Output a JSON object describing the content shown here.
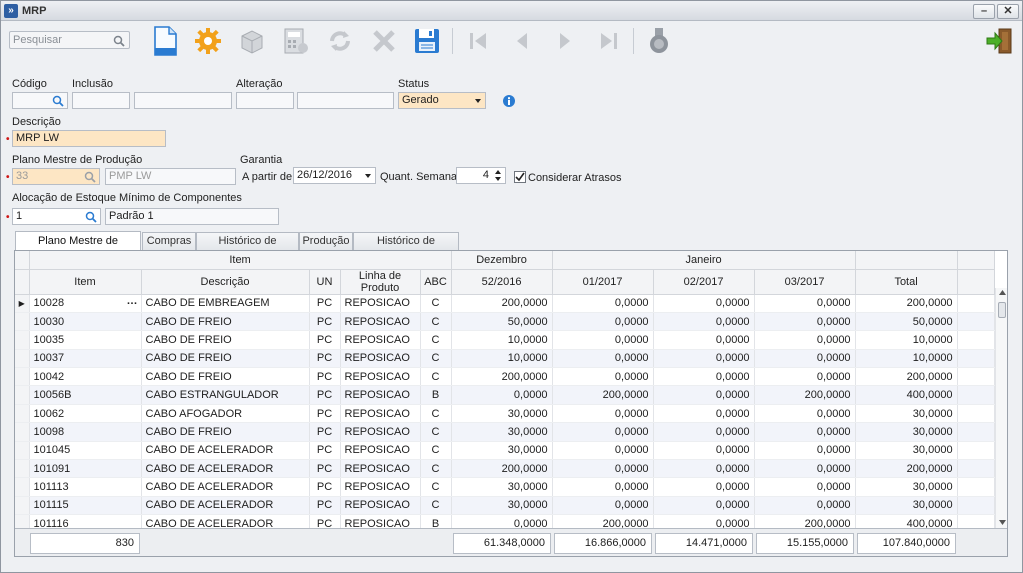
{
  "window": {
    "title": "MRP",
    "app_icon": "»",
    "min_label": "–",
    "close_label": "✕"
  },
  "toolbar": {
    "search_placeholder": "Pesquisar",
    "buttons": [
      "new-document-icon",
      "settings-gear-icon",
      "package-icon",
      "calculator-icon",
      "refresh-icon",
      "delete-x-icon",
      "save-disk-icon",
      "first-record-icon",
      "previous-record-icon",
      "next-record-icon",
      "last-record-icon",
      "medal-icon",
      "exit-door-icon"
    ]
  },
  "form": {
    "codigo_label": "Código",
    "inclusao_label": "Inclusão",
    "alteracao_label": "Alteração",
    "status_label": "Status",
    "status_value": "Gerado",
    "descricao_label": "Descrição",
    "descricao_value": "MRP LW",
    "plano_label": "Plano Mestre de Produção",
    "plano_code": "33",
    "plano_name": "PMP LW",
    "garantia_label": "Garantia",
    "a_partir_label": "A partir de",
    "a_partir_value": "26/12/2016",
    "quant_semanas_label": "Quant. Semanas",
    "quant_semanas_value": "4",
    "considerar_label": "Considerar Atrasos",
    "considerar_checked": true,
    "alocacao_label": "Alocação de Estoque Mínimo de Componentes",
    "alocacao_code": "1",
    "alocacao_name": "Padrão 1"
  },
  "tabs": [
    "Plano Mestre de Produção",
    "Compras",
    "Histórico de Compras",
    "Produção",
    "Histórico de Produção"
  ],
  "grid": {
    "group_headers": {
      "item": "Item",
      "dezembro": "Dezembro",
      "janeiro": "Janeiro"
    },
    "columns": [
      "Item",
      "Descrição",
      "UN",
      "Linha de Produto",
      "ABC",
      "52/2016",
      "01/2017",
      "02/2017",
      "03/2017",
      "Total"
    ],
    "rows": [
      [
        "10028",
        "CABO DE EMBREAGEM",
        "PC",
        "REPOSICAO",
        "C",
        "200,0000",
        "0,0000",
        "0,0000",
        "0,0000",
        "200,0000"
      ],
      [
        "10030",
        "CABO DE FREIO",
        "PC",
        "REPOSICAO",
        "C",
        "50,0000",
        "0,0000",
        "0,0000",
        "0,0000",
        "50,0000"
      ],
      [
        "10035",
        "CABO DE FREIO",
        "PC",
        "REPOSICAO",
        "C",
        "10,0000",
        "0,0000",
        "0,0000",
        "0,0000",
        "10,0000"
      ],
      [
        "10037",
        "CABO DE FREIO",
        "PC",
        "REPOSICAO",
        "C",
        "10,0000",
        "0,0000",
        "0,0000",
        "0,0000",
        "10,0000"
      ],
      [
        "10042",
        "CABO DE FREIO",
        "PC",
        "REPOSICAO",
        "C",
        "200,0000",
        "0,0000",
        "0,0000",
        "0,0000",
        "200,0000"
      ],
      [
        "10056B",
        "CABO ESTRANGULADOR",
        "PC",
        "REPOSICAO",
        "B",
        "0,0000",
        "200,0000",
        "0,0000",
        "200,0000",
        "400,0000"
      ],
      [
        "10062",
        "CABO AFOGADOR",
        "PC",
        "REPOSICAO",
        "C",
        "30,0000",
        "0,0000",
        "0,0000",
        "0,0000",
        "30,0000"
      ],
      [
        "10098",
        "CABO DE FREIO",
        "PC",
        "REPOSICAO",
        "C",
        "30,0000",
        "0,0000",
        "0,0000",
        "0,0000",
        "30,0000"
      ],
      [
        "101045",
        "CABO DE ACELERADOR",
        "PC",
        "REPOSICAO",
        "C",
        "30,0000",
        "0,0000",
        "0,0000",
        "0,0000",
        "30,0000"
      ],
      [
        "101091",
        "CABO DE ACELERADOR",
        "PC",
        "REPOSICAO",
        "C",
        "200,0000",
        "0,0000",
        "0,0000",
        "0,0000",
        "200,0000"
      ],
      [
        "101113",
        "CABO DE ACELERADOR",
        "PC",
        "REPOSICAO",
        "C",
        "30,0000",
        "0,0000",
        "0,0000",
        "0,0000",
        "30,0000"
      ],
      [
        "101115",
        "CABO DE ACELERADOR",
        "PC",
        "REPOSICAO",
        "C",
        "30,0000",
        "0,0000",
        "0,0000",
        "0,0000",
        "30,0000"
      ],
      [
        "101116",
        "CABO DE ACELERADOR",
        "PC",
        "REPOSICAO",
        "B",
        "0,0000",
        "200,0000",
        "0,0000",
        "200,0000",
        "400,0000"
      ]
    ],
    "footer": {
      "count": "830",
      "w52": "61.348,0000",
      "w01": "16.866,0000",
      "w02": "14.471,0000",
      "w03": "15.155,0000",
      "total": "107.840,0000"
    }
  },
  "colors": {
    "required_field_bg": "#fde6c4",
    "accent": "#2e5fa3",
    "required_marker": "#d01818"
  }
}
